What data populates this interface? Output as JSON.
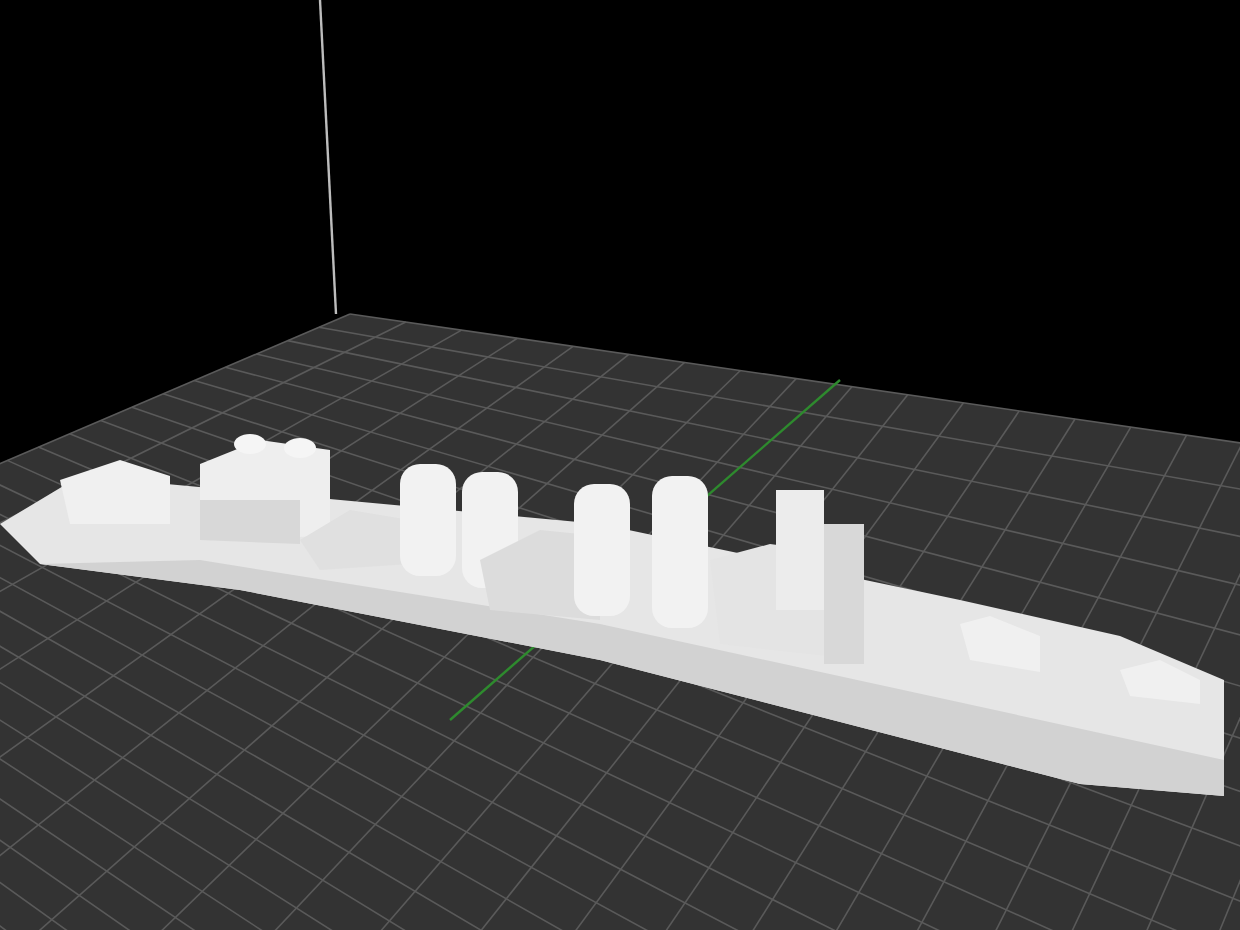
{
  "viewport": {
    "kind": "model-view",
    "grid": true,
    "axis": true
  }
}
